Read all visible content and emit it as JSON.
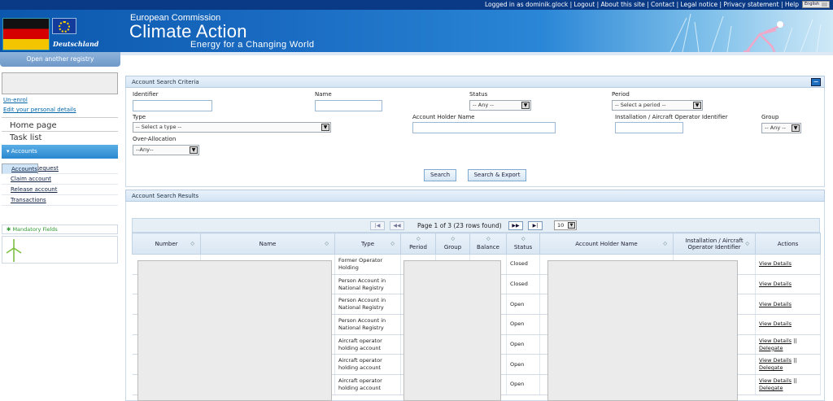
{
  "topbar": {
    "logged_in": "Logged in as dominik.glock",
    "sep": "|",
    "links": [
      "Logout",
      "About this site",
      "Contact",
      "Legal notice",
      "Privacy statement",
      "Help"
    ],
    "language": "English"
  },
  "banner": {
    "country": "Deutschland",
    "org": "European Commission",
    "title": "Climate Action",
    "tagline": "Energy for a Changing World"
  },
  "sidebar": {
    "open_registry": "Open another registry",
    "unenrol": "Un-enrol",
    "edit_details": "Edit your personal details",
    "home": "Home page",
    "tasks": "Task list",
    "accounts_header": "Accounts",
    "account_items": [
      "Accounts",
      "Account Request",
      "Claim account",
      "Release account",
      "Transactions"
    ],
    "mandatory": "Mandatory Fields"
  },
  "criteria": {
    "title": "Account Search Criteria",
    "collapse": "−",
    "identifier_label": "Identifier",
    "name_label": "Name",
    "status_label": "Status",
    "status_value": "-- Any --",
    "period_label": "Period",
    "period_value": "-- Select a period --",
    "type_label": "Type",
    "type_value": "-- Select a type --",
    "holder_label": "Account Holder Name",
    "install_label": "Installation / Aircraft Operator Identifier",
    "group_label": "Group",
    "group_value": "-- Any --",
    "overalloc_label": "Over-Allocation",
    "overalloc_value": "--Any--",
    "search": "Search",
    "search_export": "Search & Export"
  },
  "results": {
    "title": "Account Search Results",
    "page_info": "Page 1 of 3 (23 rows found)",
    "per_page": "10",
    "nav": {
      "first": "|◀",
      "prev": "◀◀",
      "next": "▶▶",
      "last": "▶|"
    },
    "columns": [
      "Number",
      "Name",
      "Type",
      "Period",
      "Group",
      "Balance",
      "Status",
      "Account Holder Name",
      "Installation / Aircraft Operator Identifier",
      "Actions"
    ],
    "rows": [
      {
        "type": "Former Operator Holding",
        "status": "Closed",
        "actions": [
          "View Details"
        ]
      },
      {
        "type": "Person Account in National Registry",
        "status": "Closed",
        "actions": [
          "View Details"
        ]
      },
      {
        "type": "Person Account in National Registry",
        "status": "Open",
        "actions": [
          "View Details"
        ]
      },
      {
        "type": "Person Account in National Registry",
        "status": "Open",
        "actions": [
          "View Details"
        ]
      },
      {
        "type": "Aircraft operator holding account",
        "status": "Open",
        "actions": [
          "View Details",
          "Delegate"
        ]
      },
      {
        "type": "Aircraft operator holding account",
        "status": "Open",
        "actions": [
          "View Details",
          "Delegate"
        ]
      },
      {
        "type": "Aircraft operator holding account",
        "status": "Open",
        "actions": [
          "View Details",
          "Delegate"
        ]
      }
    ],
    "action_sep": "||"
  }
}
